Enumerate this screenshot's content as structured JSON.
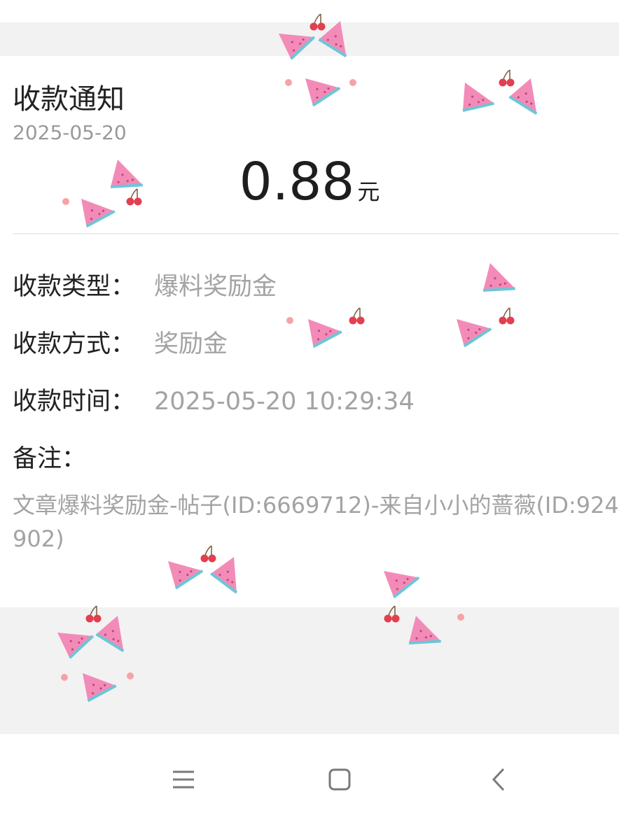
{
  "notice": {
    "title": "收款通知",
    "date": "2025-05-20",
    "amount": "0.88",
    "unit": "元"
  },
  "details": [
    {
      "label": "收款类型：",
      "value": "爆料奖励金"
    },
    {
      "label": "收款方式：",
      "value": "奖励金"
    },
    {
      "label": "收款时间：",
      "value": "2025-05-20 10:29:34"
    }
  ],
  "remark": {
    "label": "备注：",
    "text": "文章爆料奖励金-帖子(ID:6669712)-来自小小的蔷薇(ID:924902)"
  },
  "navbar": {
    "menu_icon": "menu-icon",
    "home_icon": "home-square-icon",
    "back_icon": "back-chevron-icon"
  },
  "colors": {
    "title": "#222222",
    "secondary_text": "#a3a3a3",
    "background": "#f2f2f2",
    "card": "#ffffff",
    "watermelon": "#f38bb8",
    "cherry": "#e23f4f"
  }
}
